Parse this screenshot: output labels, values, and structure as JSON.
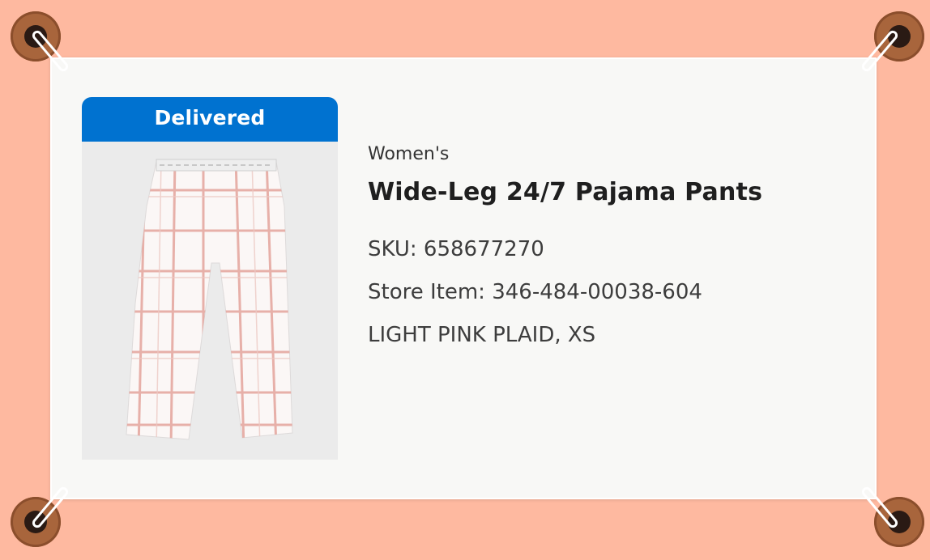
{
  "card": {
    "status": "Delivered",
    "category": "Women's",
    "title": "Wide-Leg 24/7 Pajama Pants",
    "sku": "SKU: 658677270",
    "store_item": "Store Item: 346-484-00038-604",
    "variant": "LIGHT PINK PLAID, XS"
  },
  "colors": {
    "background": "#feb9a0",
    "card": "#f8f8f6",
    "status_badge": "#0072d0",
    "plaid_line": "#e3a49c"
  },
  "icons": [
    "grommet-icon",
    "binder-clip-icon"
  ]
}
